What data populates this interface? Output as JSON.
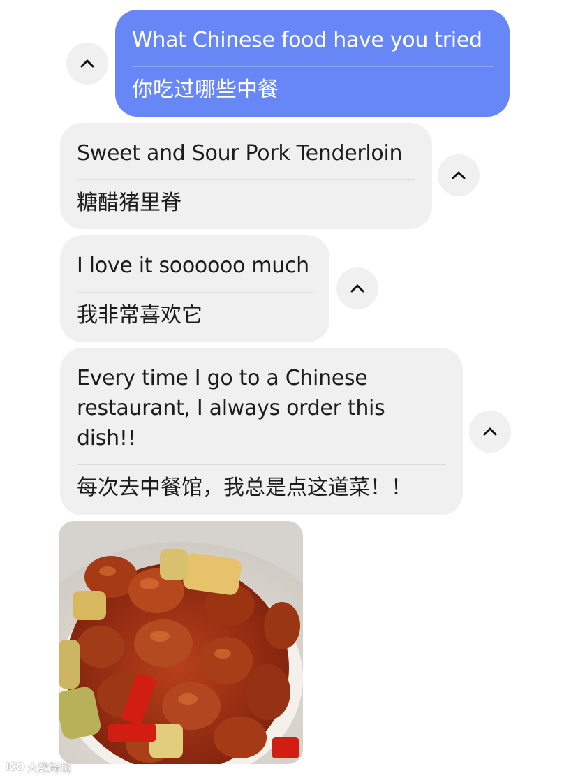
{
  "messages": [
    {
      "direction": "outgoing",
      "text": "What Chinese food have you tried",
      "translation": "你吃过哪些中餐"
    },
    {
      "direction": "incoming",
      "text": "Sweet and Sour Pork Tenderloin",
      "translation": "糖醋猪里脊"
    },
    {
      "direction": "incoming",
      "text": "I love it soooooo much",
      "translation": "我非常喜欢它"
    },
    {
      "direction": "incoming",
      "text": "Every time I go to a Chinese restaurant, I always order this dish!!",
      "translation": "每次去中餐馆，我总是点这道菜！！"
    }
  ],
  "image": {
    "description_icon": "photo"
  },
  "watermark": {
    "logo": "ICO",
    "text": "大数跨境"
  },
  "colors": {
    "outgoing_bubble": "#6787f6",
    "incoming_bubble": "#f0f0f0",
    "collapse_button": "#f0f0f0"
  }
}
